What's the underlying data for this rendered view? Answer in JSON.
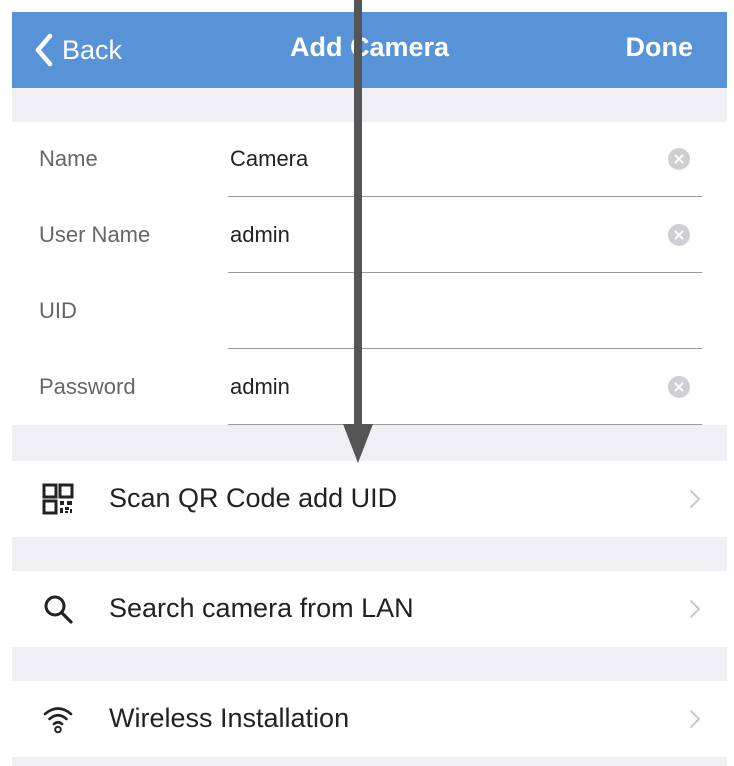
{
  "colors": {
    "nav_background": "#5793d6",
    "nav_text": "#ffffff",
    "group_separator": "#efeff4",
    "annotation_arrow": "#555555"
  },
  "navbar": {
    "back_label": "Back",
    "back_icon": "chevron-left-icon",
    "title": "Add Camera",
    "done_label": "Done"
  },
  "form": {
    "fields": [
      {
        "label": "Name",
        "value": "Camera",
        "has_clear": true
      },
      {
        "label": "User Name",
        "value": "admin",
        "has_clear": true
      },
      {
        "label": "UID",
        "value": "",
        "has_clear": false
      },
      {
        "label": "Password",
        "value": "admin",
        "has_clear": true
      }
    ]
  },
  "actions": [
    {
      "label": "Scan QR Code add UID",
      "icon": "qr-code-icon"
    },
    {
      "label": "Search camera from LAN",
      "icon": "search-icon"
    },
    {
      "label": "Wireless Installation",
      "icon": "wifi-icon"
    }
  ]
}
